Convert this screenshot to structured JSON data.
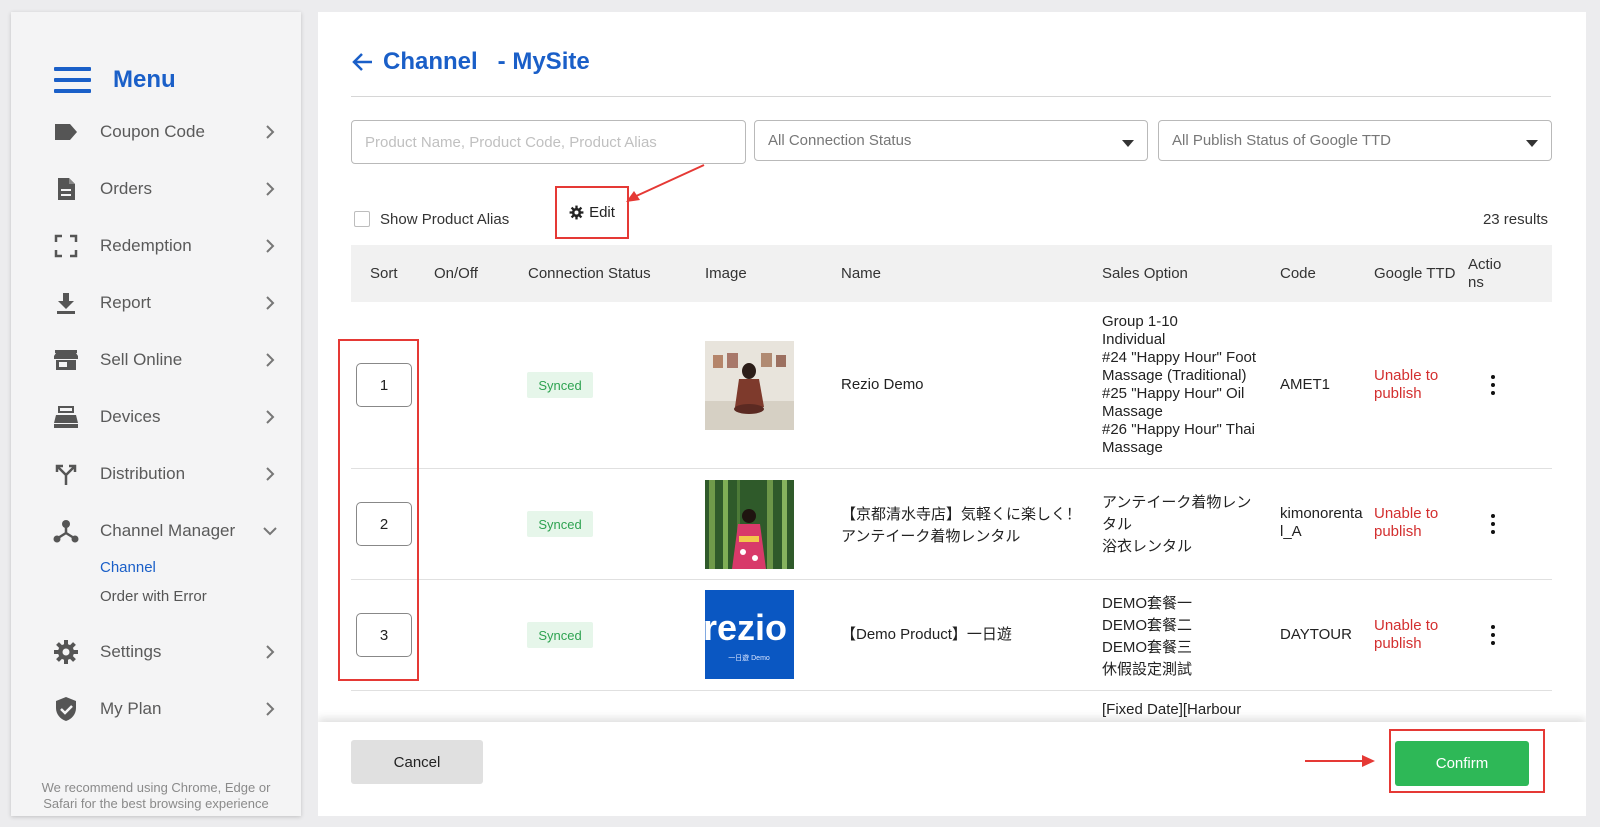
{
  "sidebar": {
    "title": "Menu",
    "items": [
      {
        "label": "Coupon Code",
        "icon": "tag-icon"
      },
      {
        "label": "Orders",
        "icon": "document-icon"
      },
      {
        "label": "Redemption",
        "icon": "scan-frame-icon"
      },
      {
        "label": "Report",
        "icon": "download-icon"
      },
      {
        "label": "Sell Online",
        "icon": "store-icon"
      },
      {
        "label": "Devices",
        "icon": "cash-register-icon"
      },
      {
        "label": "Distribution",
        "icon": "split-arrows-icon"
      },
      {
        "label": "Channel Manager",
        "icon": "hub-icon",
        "expanded": true
      },
      {
        "label": "Settings",
        "icon": "gear-icon"
      },
      {
        "label": "My Plan",
        "icon": "shield-check-icon"
      }
    ],
    "sub_items": [
      {
        "label": "Channel",
        "active": true
      },
      {
        "label": "Order with Error",
        "active": false
      }
    ],
    "browser_note": "We recommend using Chrome, Edge or Safari for the best browsing experience"
  },
  "header": {
    "title": "Channel   - MySite"
  },
  "filters": {
    "search_placeholder": "Product Name, Product Code, Product Alias",
    "connection_status": "All Connection Status",
    "publish_status": "All Publish Status of Google TTD"
  },
  "toolbar": {
    "show_alias_label": "Show Product Alias",
    "edit_label": "Edit",
    "results": "23 results"
  },
  "table": {
    "headers": [
      "Sort",
      "On/Off",
      "Connection Status",
      "Image",
      "Name",
      "Sales Option",
      "Code",
      "Google TTD",
      "Actions"
    ],
    "rows": [
      {
        "sort": "1",
        "status": "Synced",
        "name": "Rezio Demo",
        "sales_options": [
          "Group 1-10",
          "Individual",
          "#24 \"Happy Hour\" Foot Massage (Traditional)",
          "#25 \"Happy Hour\" Oil Massage",
          "#26 \"Happy Hour\" Thai Massage"
        ],
        "code": "AMET1",
        "google_ttd": "Unable to publish"
      },
      {
        "sort": "2",
        "status": "Synced",
        "name": "【京都清水寺店】気軽くに楽しく！アンテイーク着物レンタル",
        "sales_options": [
          "アンテイーク着物レンタル",
          "浴衣レンタル"
        ],
        "code": "kimonorental_A",
        "google_ttd": "Unable to publish"
      },
      {
        "sort": "3",
        "status": "Synced",
        "name": "【Demo Product】一日遊",
        "sales_options": [
          "DEMO套餐一",
          "DEMO套餐二",
          "DEMO套餐三",
          "休假設定測試"
        ],
        "code": "DAYTOUR",
        "google_ttd": "Unable to publish"
      },
      {
        "sales_options": [
          "[Fixed Date][Harbour"
        ]
      }
    ],
    "thumb3_brand": "rezio",
    "thumb3_caption": "一日遊 Demo"
  },
  "footer": {
    "cancel_label": "Cancel",
    "confirm_label": "Confirm"
  },
  "colors": {
    "brand_blue": "#1a5fc8",
    "confirm_green": "#2eb857",
    "annotation_red": "#e53935",
    "synced_green": "#2ea351",
    "error_red": "#d32f2f"
  }
}
